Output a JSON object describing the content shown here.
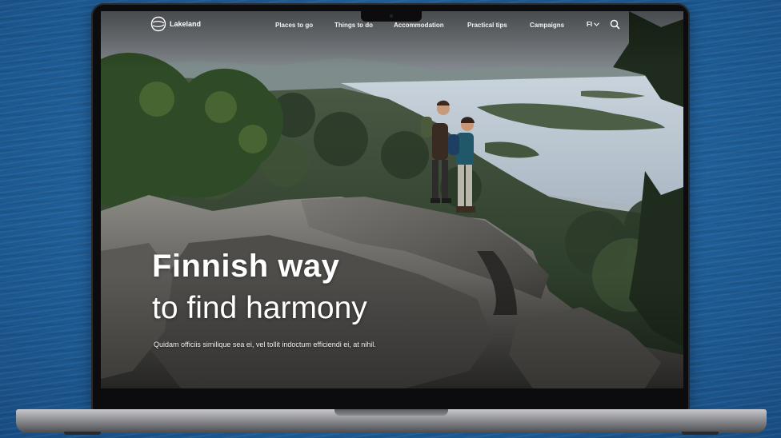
{
  "site": {
    "brand": "Lakeland",
    "logo_icon": "lakeland-logo-icon"
  },
  "nav": {
    "items": [
      {
        "label": "Places to go"
      },
      {
        "label": "Things to do"
      },
      {
        "label": "Accommodation"
      },
      {
        "label": "Practical tips"
      },
      {
        "label": "Campaigns"
      }
    ],
    "language": "FI",
    "language_icon": "chevron-down-icon",
    "search_icon": "search-icon"
  },
  "hero": {
    "title": "Finnish way",
    "subtitle": "to find harmony",
    "body": "Quidam officiis similique sea ei, vel tollit indoctum efficiendi ei, at nihil."
  },
  "colors": {
    "background_water": "#21639f",
    "laptop_body": "#0c0c0e",
    "laptop_base": "#8d8e92",
    "hero_text": "#ffffff"
  }
}
